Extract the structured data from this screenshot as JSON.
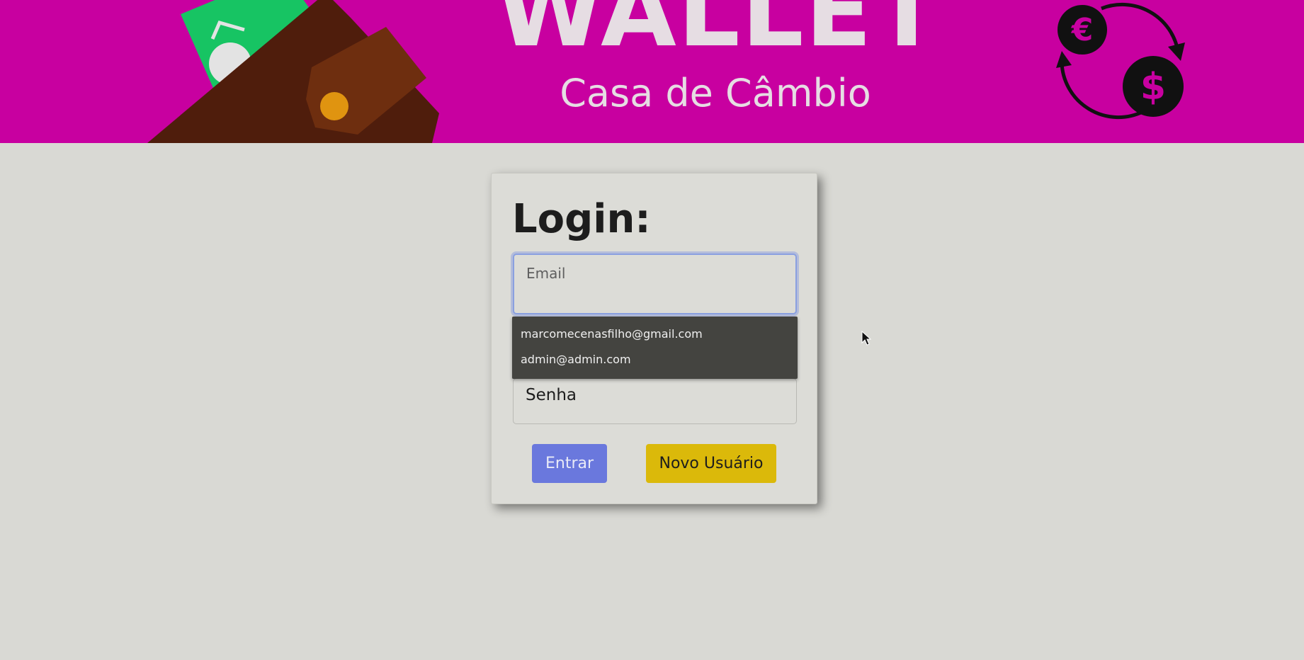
{
  "banner": {
    "title": "WALLET",
    "subtitle": "Casa de Câmbio",
    "currency_icons": {
      "euro": "€",
      "dollar": "$"
    }
  },
  "login": {
    "title": "Login:",
    "email_label": "Email",
    "password_label": "Senha",
    "autocomplete": [
      "marcomecenasfilho@gmail.com",
      "admin@admin.com"
    ],
    "enter_label": "Entrar",
    "new_user_label": "Novo Usuário"
  },
  "colors": {
    "banner": "#c800a0",
    "page_background": "#d9d9d4",
    "enter_button": "#6a78dd",
    "new_user_button": "#dbb90a",
    "autocomplete_bg": "#444440"
  }
}
